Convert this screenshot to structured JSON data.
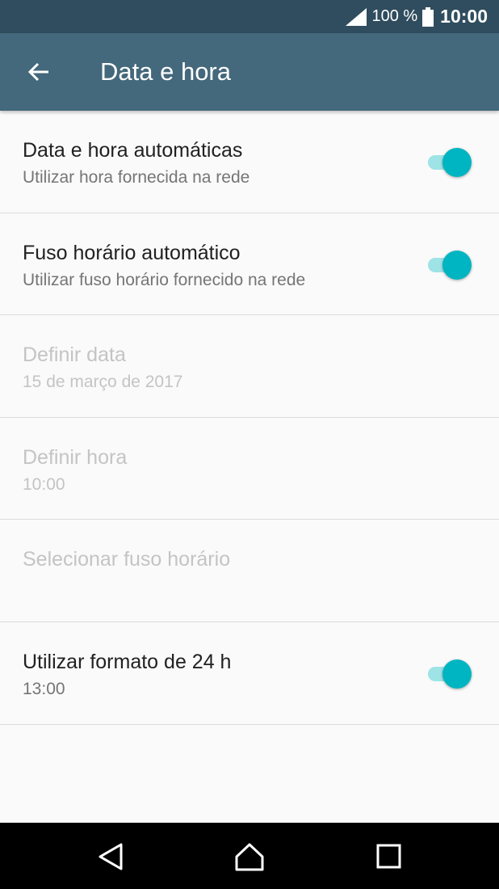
{
  "status_bar": {
    "battery_percent": "100 %",
    "time": "10:00"
  },
  "app_bar": {
    "title": "Data e hora"
  },
  "settings": [
    {
      "primary": "Data e hora automáticas",
      "secondary": "Utilizar hora fornecida na rede",
      "enabled": true,
      "toggle": true
    },
    {
      "primary": "Fuso horário automático",
      "secondary": "Utilizar fuso horário fornecido na rede",
      "enabled": true,
      "toggle": true
    },
    {
      "primary": "Definir data",
      "secondary": "15 de março de 2017",
      "enabled": false
    },
    {
      "primary": "Definir hora",
      "secondary": "10:00",
      "enabled": false
    },
    {
      "primary": "Selecionar fuso horário",
      "secondary": "",
      "enabled": false
    },
    {
      "primary": "Utilizar formato de 24 h",
      "secondary": "13:00",
      "enabled": true,
      "toggle": true
    }
  ],
  "colors": {
    "status_bar": "#2f4d5e",
    "app_bar": "#44687c",
    "accent": "#00b5c2",
    "toggle_track": "#9ee3e6"
  },
  "icons": {
    "back": "arrow-left-icon",
    "signal": "signal-icon",
    "battery": "battery-icon",
    "nav_back": "triangle-back-icon",
    "nav_home": "home-icon",
    "nav_recents": "square-recents-icon"
  }
}
